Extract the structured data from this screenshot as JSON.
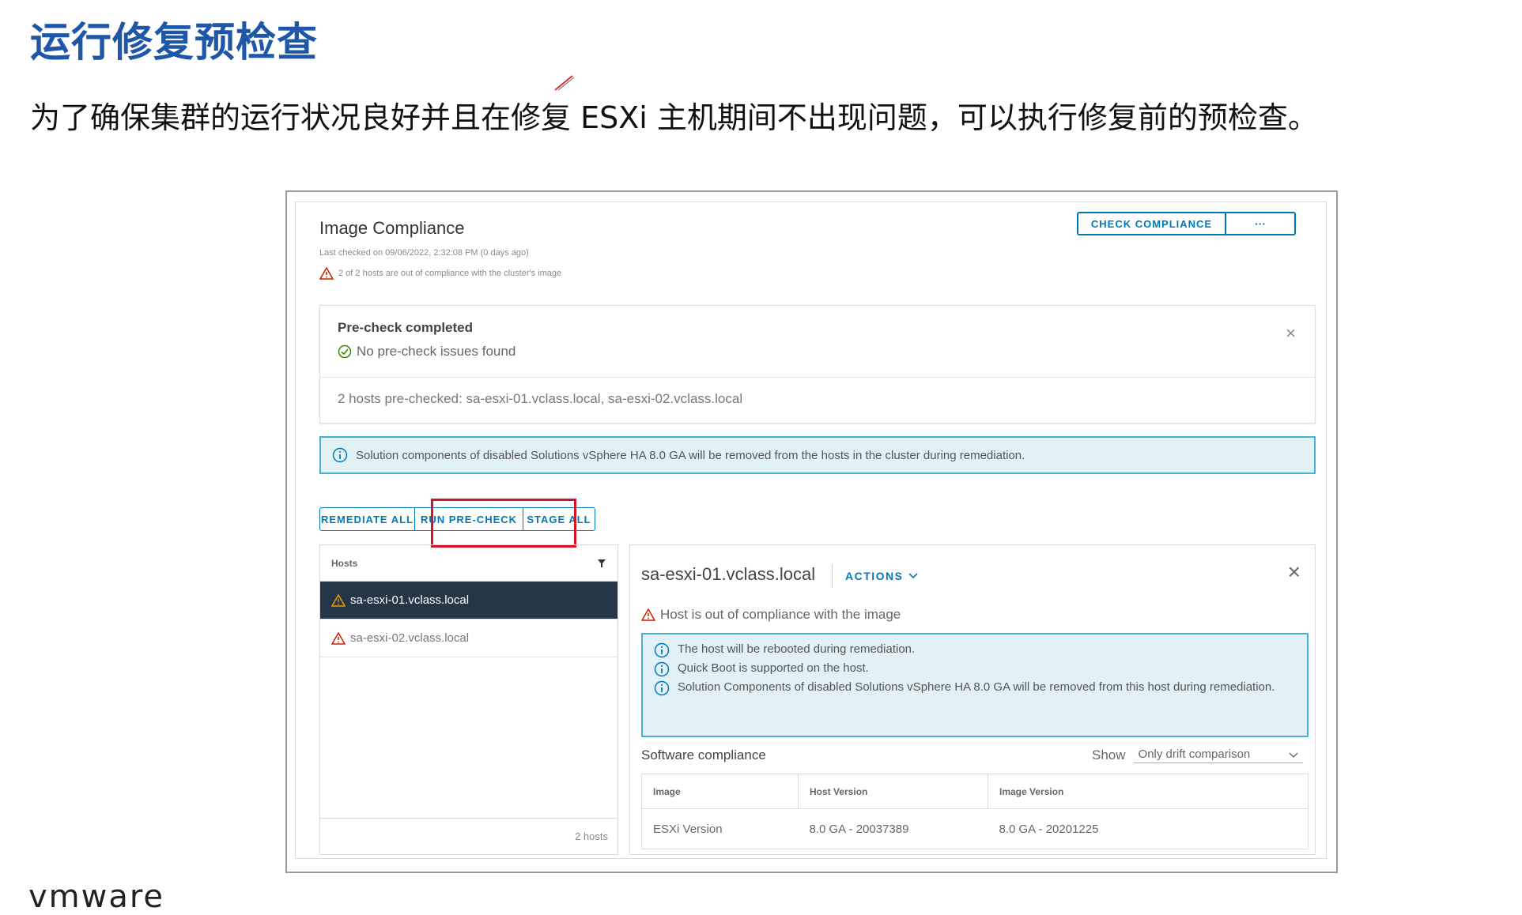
{
  "slide": {
    "title": "运行修复预检查",
    "subtitle": "为了确保集群的运行状况良好并且在修复 ESXi 主机期间不出现问题，可以执行修复前的预检查。"
  },
  "compliance": {
    "title": "Image Compliance",
    "last_checked": "Last checked on 09/06/2022, 2:32:08 PM (0 days ago)",
    "warning": "2 of 2 hosts are out of compliance with the cluster's image",
    "check_button": "CHECK COMPLIANCE",
    "more_button": "···"
  },
  "precheck": {
    "title": "Pre-check completed",
    "status": "No pre-check issues found",
    "hosts_checked": "2 hosts pre-checked: sa-esxi-01.vclass.local, sa-esxi-02.vclass.local",
    "close": "×"
  },
  "info_banner": "Solution components of disabled Solutions vSphere HA 8.0 GA will be removed from the hosts in the cluster during remediation.",
  "actions": {
    "remediate_all": "REMEDIATE ALL",
    "run_precheck": "RUN PRE-CHECK",
    "stage_all": "STAGE ALL"
  },
  "hosts": {
    "header": "Hosts",
    "items": [
      {
        "name": "sa-esxi-01.vclass.local"
      },
      {
        "name": "sa-esxi-02.vclass.local"
      }
    ],
    "footer": "2 hosts"
  },
  "detail": {
    "host": "sa-esxi-01.vclass.local",
    "actions": "ACTIONS",
    "close": "×",
    "warning": "Host is out of compliance with the image",
    "info": [
      "The host will be rebooted during remediation.",
      "Quick Boot is supported on the host.",
      "Solution Components of disabled Solutions vSphere HA 8.0 GA will be removed from this host during remediation."
    ],
    "software_compliance": "Software compliance",
    "show_label": "Show",
    "show_value": "Only drift comparison",
    "table": {
      "headers": [
        "Image",
        "Host Version",
        "Image Version"
      ],
      "rows": [
        [
          "ESXi Version",
          "8.0 GA - 20037389",
          "8.0 GA - 20201225"
        ]
      ]
    }
  },
  "colors": {
    "title_blue": "#1f57a8",
    "accent": "#0079b8",
    "info_border": "#49afd9",
    "info_bg": "#e1f1f6",
    "selected_row": "#253646",
    "highlight": "#d0142a",
    "warning": "#c92100"
  },
  "logo": "vmware"
}
